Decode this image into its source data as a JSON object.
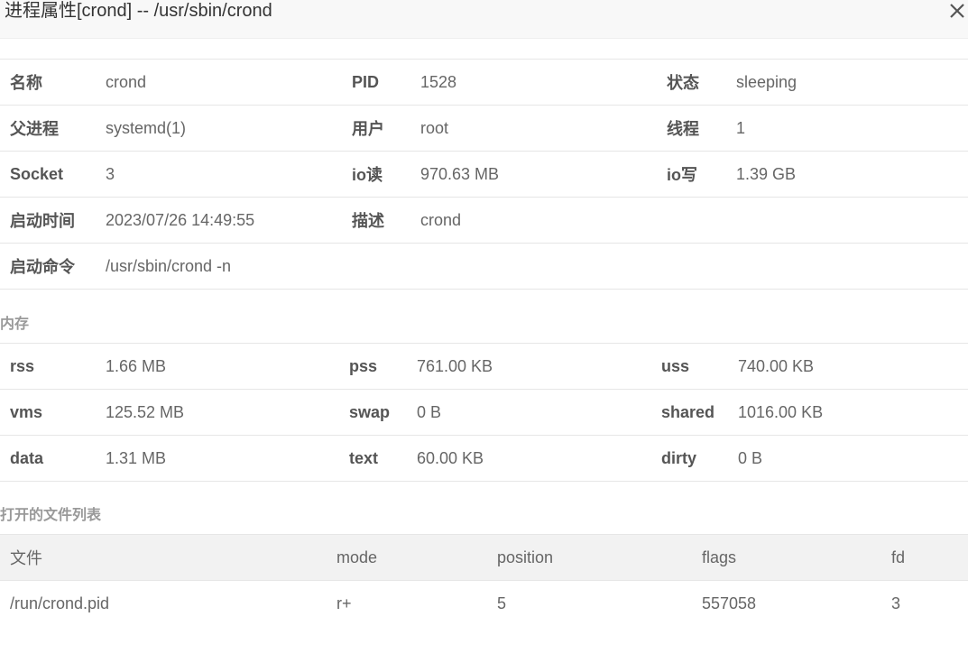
{
  "title": "进程属性[crond] -- /usr/sbin/crond",
  "basic": [
    [
      {
        "label": "名称",
        "value": "crond"
      },
      {
        "label": "PID",
        "value": "1528"
      },
      {
        "label": "状态",
        "value": "sleeping"
      }
    ],
    [
      {
        "label": "父进程",
        "value": "systemd(1)"
      },
      {
        "label": "用户",
        "value": "root"
      },
      {
        "label": "线程",
        "value": "1"
      }
    ],
    [
      {
        "label": "Socket",
        "value": "3"
      },
      {
        "label": "io读",
        "value": "970.63 MB"
      },
      {
        "label": "io写",
        "value": "1.39 GB"
      }
    ],
    [
      {
        "label": "启动时间",
        "value": "2023/07/26 14:49:55"
      },
      {
        "label": "描述",
        "value": "crond"
      }
    ],
    [
      {
        "label": "启动命令",
        "value": "/usr/sbin/crond -n"
      }
    ]
  ],
  "memory_title": "内存",
  "memory": [
    [
      {
        "label": "rss",
        "value": "1.66 MB"
      },
      {
        "label": "pss",
        "value": "761.00 KB"
      },
      {
        "label": "uss",
        "value": "740.00 KB"
      }
    ],
    [
      {
        "label": "vms",
        "value": "125.52 MB"
      },
      {
        "label": "swap",
        "value": "0 B"
      },
      {
        "label": "shared",
        "value": "1016.00 KB"
      }
    ],
    [
      {
        "label": "data",
        "value": "1.31 MB"
      },
      {
        "label": "text",
        "value": "60.00 KB"
      },
      {
        "label": "dirty",
        "value": "0 B"
      }
    ]
  ],
  "files_title": "打开的文件列表",
  "files": {
    "headers": [
      "文件",
      "mode",
      "position",
      "flags",
      "fd"
    ],
    "rows": [
      [
        "/run/crond.pid",
        "r+",
        "5",
        "557058",
        "3"
      ]
    ]
  },
  "icons": {
    "close": "close-icon"
  }
}
